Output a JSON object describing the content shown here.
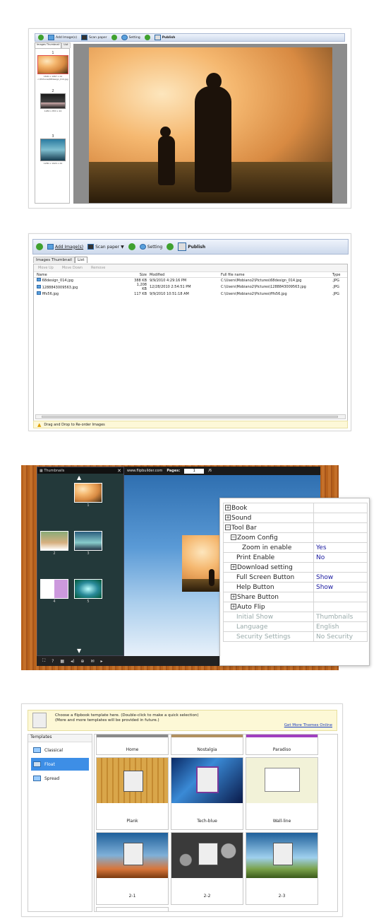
{
  "shot1": {
    "toolbar": {
      "add": "Add Image(s)",
      "scan": "Scan paper",
      "setting": "Setting",
      "publish": "Publish"
    },
    "tabs": [
      "Images Thumbnail",
      "List"
    ],
    "thumbs": [
      {
        "num": "1",
        "cap": "1600 x 1067 x 24\nc:\\Pictures\\68design_014.jpg"
      },
      {
        "num": "2",
        "cap": "1280 x 853 x 24"
      },
      {
        "num": "3",
        "cap": "1280 x 1024 x 24"
      }
    ]
  },
  "shot2": {
    "toolbar": {
      "add": "Add Image(s)",
      "scan": "Scan paper",
      "setting": "Setting",
      "publish": "Publish"
    },
    "tabs": [
      "Images Thumbnail",
      "List"
    ],
    "subtoolbar": [
      "Move Up",
      "Move Down",
      "Remove"
    ],
    "columns": [
      "Name",
      "Size",
      "Modified",
      "Full file name",
      "Type"
    ],
    "rows": [
      [
        "68design_014.jpg",
        "388 KB",
        "9/9/2010 4:29:16 PM",
        "C:\\Users\\Mobiano2\\Pictures\\68design_014.jpg",
        ".JPG"
      ],
      [
        "1288843009563.jpg",
        "1,208 KB",
        "12/28/2010 2:54:51 PM",
        "C:\\Users\\Mobiano2\\Pictures\\1288843009563.jpg",
        ".JPG"
      ],
      [
        "fffs56.jpg",
        "117 KB",
        "9/9/2010 10:51:18 AM",
        "C:\\Users\\Mobiano2\\Pictures\\fffs56.jpg",
        ".JPG"
      ]
    ],
    "status": "Drag and Drop to Re-order Images"
  },
  "shot3": {
    "panel_title": "Thumbnails",
    "viewer_url": "www.flipbuilder.com",
    "pages_label": "Pages:",
    "page_current": "1",
    "page_total": "/6",
    "thumb_nums": [
      "1",
      "2",
      "3",
      "4",
      "5"
    ],
    "props": [
      {
        "label": "Book",
        "value": "",
        "indent": 0,
        "sign": "+"
      },
      {
        "label": "Sound",
        "value": "",
        "indent": 0,
        "sign": "+"
      },
      {
        "label": "Tool Bar",
        "value": "",
        "indent": 0,
        "sign": "-"
      },
      {
        "label": "Zoom Config",
        "value": "",
        "indent": 1,
        "sign": "-"
      },
      {
        "label": "Zoom in enable",
        "value": "Yes",
        "indent": 3,
        "sign": ""
      },
      {
        "label": "Print Enable",
        "value": "No",
        "indent": 2,
        "sign": ""
      },
      {
        "label": "Download setting",
        "value": "",
        "indent": 1,
        "sign": "+"
      },
      {
        "label": "Full Screen Button",
        "value": "Show",
        "indent": 2,
        "sign": ""
      },
      {
        "label": "Help Button",
        "value": "Show",
        "indent": 2,
        "sign": ""
      },
      {
        "label": "Share Button",
        "value": "",
        "indent": 1,
        "sign": "+"
      },
      {
        "label": "Auto Flip",
        "value": "",
        "indent": 1,
        "sign": "+"
      },
      {
        "label": "Initial Show",
        "value": "Thumbnails",
        "indent": 2,
        "sign": "",
        "dim": true
      },
      {
        "label": "Language",
        "value": "English",
        "indent": 2,
        "sign": "",
        "dim": true
      },
      {
        "label": "Security Settings",
        "value": "No Security",
        "indent": 2,
        "sign": "",
        "dim": true
      }
    ]
  },
  "shot4": {
    "hint1": "Choose a flipbook template here. (Double-click to make a quick selection)",
    "hint2": "(More and more templates will be provided in future.)",
    "more_link": "Get More Themes Online",
    "templates_header": "Templates",
    "categories": [
      "Classical",
      "Float",
      "Spread"
    ],
    "selected_category": "Float",
    "tiles_row0": [
      "Home",
      "Nostalgia",
      "Paradiso"
    ],
    "tiles_row1": [
      "Plank",
      "Tech-blue",
      "Wall-line"
    ],
    "tiles_row2": [
      "2-1",
      "2-2",
      "2-3"
    ]
  }
}
